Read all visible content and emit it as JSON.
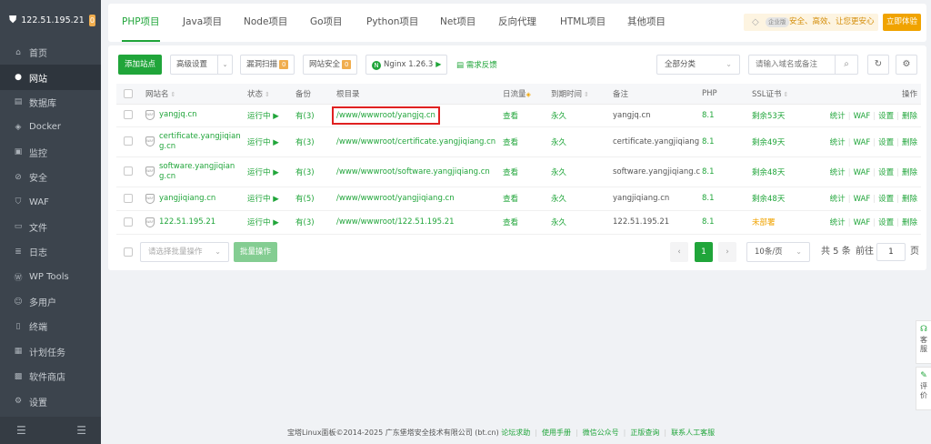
{
  "sidebar": {
    "server_ip": "122.51.195.21",
    "alert_count": "0",
    "items": [
      {
        "label": "首页",
        "icon": "home-icon",
        "glyph": "⌂"
      },
      {
        "label": "网站",
        "icon": "globe-icon",
        "glyph": "●"
      },
      {
        "label": "数据库",
        "icon": "database-icon",
        "glyph": "▤"
      },
      {
        "label": "Docker",
        "icon": "docker-icon",
        "glyph": "◈"
      },
      {
        "label": "监控",
        "icon": "monitor-icon",
        "glyph": "▣"
      },
      {
        "label": "安全",
        "icon": "shield-check-icon",
        "glyph": "⊘"
      },
      {
        "label": "WAF",
        "icon": "waf-shield-icon",
        "glyph": "⛉"
      },
      {
        "label": "文件",
        "icon": "folder-icon",
        "glyph": "▭"
      },
      {
        "label": "日志",
        "icon": "log-icon",
        "glyph": "≣"
      },
      {
        "label": "WP Tools",
        "icon": "wordpress-icon",
        "glyph": "Ⓦ"
      },
      {
        "label": "多用户",
        "icon": "users-icon",
        "glyph": "☺"
      },
      {
        "label": "终端",
        "icon": "terminal-icon",
        "glyph": "▯"
      },
      {
        "label": "计划任务",
        "icon": "schedule-icon",
        "glyph": "▦"
      },
      {
        "label": "软件商店",
        "icon": "app-store-icon",
        "glyph": "▩"
      },
      {
        "label": "设置",
        "icon": "settings-icon",
        "glyph": "⚙"
      }
    ],
    "active_index": 1
  },
  "top_tabs": [
    "PHP项目",
    "Java项目",
    "Node项目",
    "Go项目",
    "Python项目",
    "Net项目",
    "反向代理",
    "HTML项目",
    "其他项目"
  ],
  "enterprise": {
    "tag": "企业版",
    "slogan": "安全、高效、让您更安心",
    "trial": "立即体验"
  },
  "toolbar": {
    "add_site": "添加站点",
    "advanced": "高级设置",
    "vuln_scan": "漏洞扫描",
    "vuln_count": "0",
    "site_security": "网站安全",
    "security_count": "0",
    "nginx": "Nginx 1.26.3",
    "feedback": "需求反馈",
    "category": "全部分类",
    "search_placeholder": "请输入域名或备注"
  },
  "table": {
    "headers": {
      "name": "网站名",
      "status": "状态",
      "backup": "备份",
      "root": "根目录",
      "traffic": "日流量",
      "expire": "到期时间",
      "remark": "备注",
      "php": "PHP",
      "ssl": "SSL证书",
      "ops": "操作"
    },
    "rows": [
      {
        "name": "yangjq.cn",
        "status": "运行中",
        "backup": "有(3)",
        "root": "/www/wwwroot/yangjq.cn",
        "traffic": "查看",
        "expire": "永久",
        "remark": "yangjq.cn",
        "php": "8.1",
        "ssl": "剩余53天"
      },
      {
        "name": "certificate.yangjiqiang.cn",
        "status": "运行中",
        "backup": "有(3)",
        "root": "/www/wwwroot/certificate.yangjiqiang.cn",
        "traffic": "查看",
        "expire": "永久",
        "remark": "certificate.yangjiqiang",
        "php": "8.1",
        "ssl": "剩余49天"
      },
      {
        "name": "software.yangjiqiang.cn",
        "status": "运行中",
        "backup": "有(3)",
        "root": "/www/wwwroot/software.yangjiqiang.cn",
        "traffic": "查看",
        "expire": "永久",
        "remark": "software.yangjiqiang.c",
        "php": "8.1",
        "ssl": "剩余48天"
      },
      {
        "name": "yangjiqiang.cn",
        "status": "运行中",
        "backup": "有(5)",
        "root": "/www/wwwroot/yangjiqiang.cn",
        "traffic": "查看",
        "expire": "永久",
        "remark": "yangjiqiang.cn",
        "php": "8.1",
        "ssl": "剩余48天"
      },
      {
        "name": "122.51.195.21",
        "status": "运行中",
        "backup": "有(3)",
        "root": "/www/wwwroot/122.51.195.21",
        "traffic": "查看",
        "expire": "永久",
        "remark": "122.51.195.21",
        "php": "8.1",
        "ssl": "未部署"
      }
    ],
    "ops": [
      "统计",
      "WAF",
      "设置",
      "删除"
    ],
    "highlight_row": 0
  },
  "batch": {
    "placeholder": "请选择批量操作",
    "button": "批量操作"
  },
  "pager": {
    "prev": "‹",
    "current": "1",
    "next": "›",
    "per_page": "10条/页",
    "total": "共 5 条",
    "goto_label": "前往",
    "goto_value": "1",
    "page_suffix": "页"
  },
  "footer": {
    "copyright": "宝塔Linux面板©2014-2025 广东堡塔安全技术有限公司 (bt.cn)",
    "links": [
      "论坛求助",
      "使用手册",
      "微信公众号",
      "正版查询",
      "联系人工客服"
    ]
  },
  "float": {
    "service": "客服",
    "review": "评价"
  }
}
